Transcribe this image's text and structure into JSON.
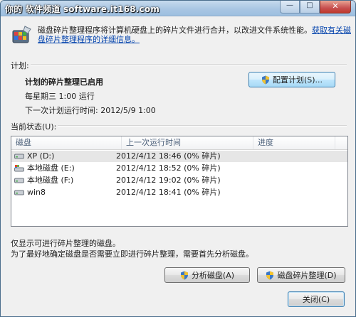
{
  "window": {
    "watermark_text": "你的 软件频道 software.it168.com",
    "controls": {
      "minimize": "—",
      "maximize": "□",
      "close": "✕"
    }
  },
  "intro": {
    "text": "磁盘碎片整理程序将计算机硬盘上的碎片文件进行合并，以改进文件系统性能。",
    "link": "获取有关磁盘碎片整理程序的详细信息。"
  },
  "schedule": {
    "section_label": "计划:",
    "status": "计划的碎片整理已启用",
    "frequency": "每星期三  1:00 运行",
    "next_run": "下一次计划运行时间: 2012/5/9 1:00",
    "configure_button": "配置计划(S)..."
  },
  "current_status": {
    "section_label": "当前状态(U):",
    "columns": [
      "磁盘",
      "上一次运行时间",
      "进度"
    ],
    "rows": [
      {
        "disk": "XP (D:)",
        "last_run": "2012/4/12 18:46 (0% 碎片)",
        "progress": "",
        "icon": "drive-icon",
        "selected": true
      },
      {
        "disk": "本地磁盘 (E:)",
        "last_run": "2012/4/12 18:52 (0% 碎片)",
        "progress": "",
        "icon": "system-drive-icon",
        "selected": false
      },
      {
        "disk": "本地磁盘 (F:)",
        "last_run": "2012/4/12 19:02 (0% 碎片)",
        "progress": "",
        "icon": "drive-icon",
        "selected": false
      },
      {
        "disk": "win8",
        "last_run": "2012/4/12 18:41 (0% 碎片)",
        "progress": "",
        "icon": "drive-icon",
        "selected": false
      }
    ]
  },
  "notes": {
    "line1": "仅显示可进行碎片整理的磁盘。",
    "line2": "为了最好地确定磁盘是否需要立即进行碎片整理，需要首先分析磁盘。"
  },
  "actions": {
    "analyze": "分析磁盘(A)",
    "defragment": "磁盘碎片整理(D)",
    "close": "关闭(C)"
  },
  "colors": {
    "accent": "#3c7fb1",
    "link": "#0645ad",
    "titlebar": "#a9c6e3"
  }
}
